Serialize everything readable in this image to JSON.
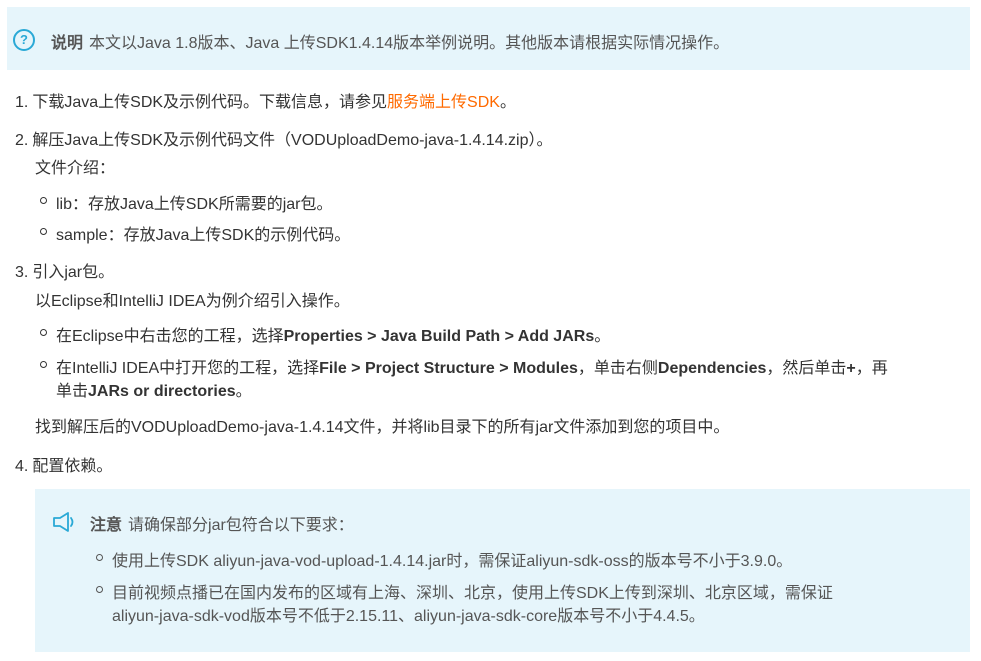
{
  "info": {
    "icon": "question-circle-icon",
    "title": "说明",
    "text": "本文以Java 1.8版本、Java 上传SDK1.4.14版本举例说明。其他版本请根据实际情况操作。"
  },
  "steps": [
    {
      "num": "1.",
      "text_before": "下载Java上传SDK及示例代码。下载信息，请参见",
      "link": "服务端上传SDK",
      "text_after": "。"
    },
    {
      "num": "2.",
      "text": "解压Java上传SDK及示例代码文件（VODUploadDemo-java-1.4.14.zip）。",
      "intro": "文件介绍：",
      "items": [
        "lib：存放Java上传SDK所需要的jar包。",
        "sample：存放Java上传SDK的示例代码。"
      ]
    },
    {
      "num": "3.",
      "text": "引入jar包。",
      "intro": "以Eclipse和IntelliJ IDEA为例介绍引入操作。",
      "item1": {
        "before": "在Eclipse中右击您的工程，选择",
        "bold": "Properties > Java Build Path > Add JARs",
        "after": "。"
      },
      "item2": {
        "before": "在IntelliJ IDEA中打开您的工程，选择",
        "bold1": "File > Project Structure > Modules",
        "mid1": "，单击右侧",
        "bold2": "Dependencies",
        "mid2": "，然后单击",
        "bold3": "+",
        "mid3": "，再",
        "line2_before": "单击",
        "bold4": "JARs or directories",
        "line2_after": "。"
      },
      "outro": "找到解压后的VODUploadDemo-java-1.4.14文件，并将lib目录下的所有jar文件添加到您的项目中。"
    },
    {
      "num": "4.",
      "text": "配置依赖。"
    }
  ],
  "note": {
    "icon": "speaker-icon",
    "title": "注意",
    "text": "请确保部分jar包符合以下要求：",
    "item1": "使用上传SDK aliyun-java-vod-upload-1.4.14.jar时，需保证aliyun-sdk-oss的版本号不小于3.9.0。",
    "item2_line1": "目前视频点播已在国内发布的区域有上海、深圳、北京，使用上传SDK上传到深圳、北京区域，需保证",
    "item2_line2": "aliyun-java-sdk-vod版本号不低于2.15.11、aliyun-java-sdk-core版本号不小于4.4.5。"
  },
  "colors": {
    "link": "#ff6a00",
    "info_bg": "#e6f5fb",
    "icon": "#2aa9d6"
  }
}
